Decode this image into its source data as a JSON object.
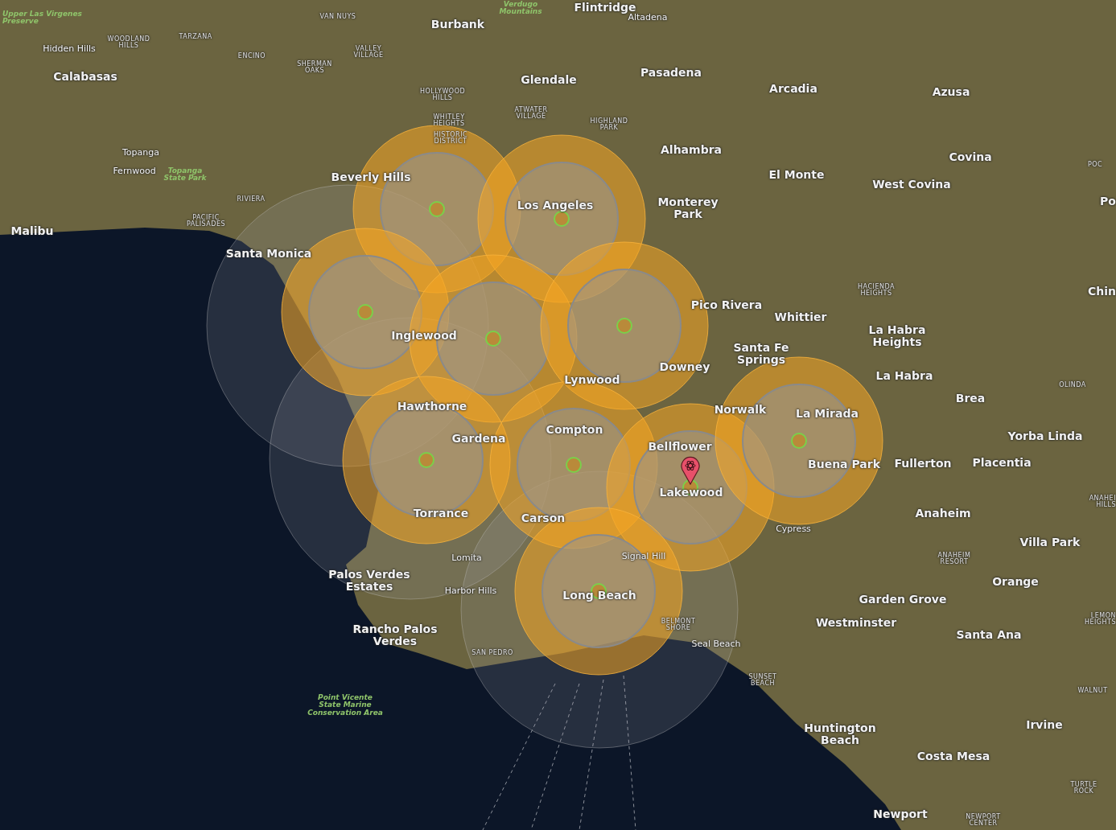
{
  "map": {
    "labels": [
      {
        "text": "Upper Las Virgenes\nPreserve",
        "kind": "park"
      },
      {
        "text": "Verdugo\nMountains",
        "kind": "park"
      },
      {
        "text": "Topanga\nState Park",
        "kind": "park"
      },
      {
        "text": "Point Vicente\nState Marine\nConservation Area",
        "kind": "park"
      },
      {
        "text": "Flintridge",
        "kind": "city"
      },
      {
        "text": "Burbank",
        "kind": "city"
      },
      {
        "text": "Glendale",
        "kind": "city"
      },
      {
        "text": "Pasadena",
        "kind": "city"
      },
      {
        "text": "Arcadia",
        "kind": "city"
      },
      {
        "text": "Azusa",
        "kind": "city"
      },
      {
        "text": "Calabasas",
        "kind": "city"
      },
      {
        "text": "Alhambra",
        "kind": "city"
      },
      {
        "text": "El Monte",
        "kind": "city"
      },
      {
        "text": "Covina",
        "kind": "city"
      },
      {
        "text": "West Covina",
        "kind": "city"
      },
      {
        "text": "Monterey\nPark",
        "kind": "city"
      },
      {
        "text": "Beverly Hills",
        "kind": "city"
      },
      {
        "text": "Los Angeles",
        "kind": "city"
      },
      {
        "text": "Malibu",
        "kind": "city"
      },
      {
        "text": "Santa Monica",
        "kind": "city"
      },
      {
        "text": "Inglewood",
        "kind": "city"
      },
      {
        "text": "Pico Rivera",
        "kind": "city"
      },
      {
        "text": "Whittier",
        "kind": "city"
      },
      {
        "text": "Santa Fe\nSprings",
        "kind": "city"
      },
      {
        "text": "La Habra\nHeights",
        "kind": "city"
      },
      {
        "text": "La Habra",
        "kind": "city"
      },
      {
        "text": "Downey",
        "kind": "city"
      },
      {
        "text": "Lynwood",
        "kind": "city"
      },
      {
        "text": "Hawthorne",
        "kind": "city"
      },
      {
        "text": "Gardena",
        "kind": "city"
      },
      {
        "text": "Brea",
        "kind": "city"
      },
      {
        "text": "Norwalk",
        "kind": "city"
      },
      {
        "text": "La Mirada",
        "kind": "city"
      },
      {
        "text": "Compton",
        "kind": "city"
      },
      {
        "text": "Bellflower",
        "kind": "city"
      },
      {
        "text": "Yorba Linda",
        "kind": "city"
      },
      {
        "text": "Buena Park",
        "kind": "city"
      },
      {
        "text": "Fullerton",
        "kind": "city"
      },
      {
        "text": "Placentia",
        "kind": "city"
      },
      {
        "text": "Lakewood",
        "kind": "city"
      },
      {
        "text": "Torrance",
        "kind": "city"
      },
      {
        "text": "Carson",
        "kind": "city"
      },
      {
        "text": "Anaheim",
        "kind": "city"
      },
      {
        "text": "Villa Park",
        "kind": "city"
      },
      {
        "text": "Palos Verdes\nEstates",
        "kind": "city"
      },
      {
        "text": "Orange",
        "kind": "city"
      },
      {
        "text": "Long Beach",
        "kind": "city"
      },
      {
        "text": "Garden Grove",
        "kind": "city"
      },
      {
        "text": "Westminster",
        "kind": "city"
      },
      {
        "text": "Rancho Palos\nVerdes",
        "kind": "city"
      },
      {
        "text": "Santa Ana",
        "kind": "city"
      },
      {
        "text": "Irvine",
        "kind": "city"
      },
      {
        "text": "Huntington\nBeach",
        "kind": "city"
      },
      {
        "text": "Costa Mesa",
        "kind": "city"
      },
      {
        "text": "Po",
        "kind": "city"
      },
      {
        "text": "Chin",
        "kind": "city"
      },
      {
        "text": "Newport",
        "kind": "city"
      },
      {
        "text": "Altadena",
        "kind": "town"
      },
      {
        "text": "Hidden Hills",
        "kind": "town"
      },
      {
        "text": "Topanga",
        "kind": "town"
      },
      {
        "text": "Fernwood",
        "kind": "town"
      },
      {
        "text": "Lomita",
        "kind": "town"
      },
      {
        "text": "Harbor Hills",
        "kind": "town"
      },
      {
        "text": "Signal Hill",
        "kind": "town"
      },
      {
        "text": "Cypress",
        "kind": "town"
      },
      {
        "text": "Seal Beach",
        "kind": "town"
      },
      {
        "text": "VAN NUYS",
        "kind": "district"
      },
      {
        "text": "WOODLAND\nHILLS",
        "kind": "district"
      },
      {
        "text": "TARZANA",
        "kind": "district"
      },
      {
        "text": "ENCINO",
        "kind": "district"
      },
      {
        "text": "SHERMAN\nOAKS",
        "kind": "district"
      },
      {
        "text": "VALLEY\nVILLAGE",
        "kind": "district"
      },
      {
        "text": "HOLLYWOOD\nHILLS",
        "kind": "district"
      },
      {
        "text": "WHITLEY\nHEIGHTS",
        "kind": "district"
      },
      {
        "text": "HISTORIC\nDISTRICT",
        "kind": "district"
      },
      {
        "text": "ATWATER\nVILLAGE",
        "kind": "district"
      },
      {
        "text": "HIGHLAND\nPARK",
        "kind": "district"
      },
      {
        "text": "RIVIERA",
        "kind": "district"
      },
      {
        "text": "PACIFIC\nPALISADES",
        "kind": "district"
      },
      {
        "text": "POC",
        "kind": "district"
      },
      {
        "text": "HACIENDA\nHEIGHTS",
        "kind": "district"
      },
      {
        "text": "OLINDA",
        "kind": "district"
      },
      {
        "text": "ANAHEI\nHILLS",
        "kind": "district"
      },
      {
        "text": "ANAHEIM\nRESORT",
        "kind": "district"
      },
      {
        "text": "LEMON\nHEIGHTS",
        "kind": "district"
      },
      {
        "text": "WALNUT",
        "kind": "district"
      },
      {
        "text": "SAN PEDRO",
        "kind": "district"
      },
      {
        "text": "BELMONT\nSHORE",
        "kind": "district"
      },
      {
        "text": "SUNSET\nBEACH",
        "kind": "district"
      },
      {
        "text": "TURTLE\nROCK",
        "kind": "district"
      },
      {
        "text": "NEWPORT\nCENTER",
        "kind": "district"
      }
    ]
  }
}
